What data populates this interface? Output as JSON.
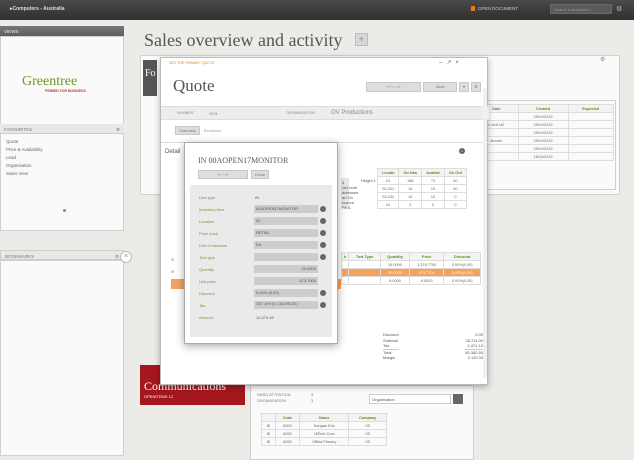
{
  "topbar": {
    "title": "▸Computers - Australia",
    "open_doc": "OPEN DOCUMENT",
    "search_placeholder": "Search a document..."
  },
  "sidebar": {
    "views_label": "VIEWS",
    "logo_main": "Greentree",
    "logo_sub": "PRIMED FOR BUSINESS",
    "favourites_label": "FAVOURITES",
    "favourites": [
      "Quote",
      "Price & Availability",
      "Lead",
      "Organisation",
      "Sales View"
    ],
    "bookmarks_label": "BOOKMARKS"
  },
  "page": {
    "title": "Sales overview and activity",
    "plus": "+"
  },
  "tile_letters": "Fo",
  "communications": {
    "title": "Communications",
    "sub": "OPENITEMS  12"
  },
  "quote": {
    "hint": "NOT THE PRIMARY QUOTE",
    "title": "Quote",
    "save_label": "Save",
    "number_label": "NUMBER",
    "number_value": "1001",
    "org_label": "ORGANISATION",
    "org_value": "OV Productions",
    "tabs": [
      "Overview",
      "Revisions"
    ],
    "details_label": "Detail",
    "contact_text": "Height 1",
    "trunc_text": [
      "4",
      "ves both",
      "ddresses",
      "an On",
      "ccount",
      "PA A"
    ]
  },
  "stock": {
    "headers": [
      "Locatn",
      "On Han",
      "Availab",
      "On Ord"
    ],
    "rows": [
      [
        "01",
        "186",
        "74",
        "60"
      ],
      [
        "02-251",
        "19",
        "19",
        "50"
      ],
      [
        "03-252",
        "10",
        "10",
        "0"
      ],
      [
        "04",
        "0",
        "0",
        "0"
      ]
    ]
  },
  "lines": {
    "headers": [
      "Text Type",
      "Quantity",
      "Price",
      "Discount"
    ],
    "rows": [
      [
        "",
        "16.0000",
        "1,376.7700",
        "0.00%(0.00)"
      ],
      [
        "",
        "20.0000",
        "473.7700",
        "0.00%(0.00)"
      ],
      [
        "",
        "8.0000",
        "6.0000",
        "0.00%(0.00)"
      ]
    ],
    "left_col": "h"
  },
  "totals": {
    "labels": [
      "Discount",
      "Subtotal",
      "Tax",
      "Total",
      "Margin"
    ],
    "values": [
      "0.00",
      "28,711.00",
      "2,471.10",
      "45,382.55",
      "2,110.30"
    ]
  },
  "item": {
    "title": "IN 00AOPEN17MONITOR",
    "close_label": "Close",
    "fields": [
      {
        "label": "Line type",
        "value": "IN"
      },
      {
        "label": "Inventory item",
        "value": "00AOPEN17MONITOR"
      },
      {
        "label": "Location",
        "value": "02"
      },
      {
        "label": "Price book",
        "value": "RETAIL"
      },
      {
        "label": "Unit of measure",
        "value": "EA"
      },
      {
        "label": "Text type",
        "value": ""
      },
      {
        "label": "Quantity",
        "value": "20.0000"
      },
      {
        "label": "Unit price",
        "value": "473.7000"
      },
      {
        "label": "Discount",
        "value": "0.00% (0.00)"
      },
      {
        "label": "Tax",
        "value": "GST 10% (0.1,324.95.231)"
      },
      {
        "label": "Amount",
        "value": "12,474.40"
      }
    ]
  },
  "right_table": {
    "headers": [
      "Date",
      "Created",
      "Expected"
    ],
    "rows": [
      [
        "",
        "29/10/2014",
        ""
      ],
      [
        "n Unit NZ",
        "29/10/2014",
        ""
      ],
      [
        "",
        "29/10/2014",
        ""
      ],
      [
        "stomer",
        "29/10/2014",
        ""
      ],
      [
        "",
        "29/10/2014",
        ""
      ],
      [
        "",
        "16/10/2014",
        ""
      ]
    ]
  },
  "bottom": {
    "info_labels": [
      "NMSG ATTENTION",
      "ORGANISATION"
    ],
    "info_values": [
      "1",
      "1"
    ],
    "select": "Organisation",
    "headers": [
      "Code",
      "Name",
      "Company"
    ],
    "rows": [
      [
        "6000",
        "Kangan Edu",
        "0S"
      ],
      [
        "6052",
        "HiTech Com",
        "0S"
      ],
      [
        "6052",
        "VBlea Primary",
        "0S"
      ]
    ]
  }
}
